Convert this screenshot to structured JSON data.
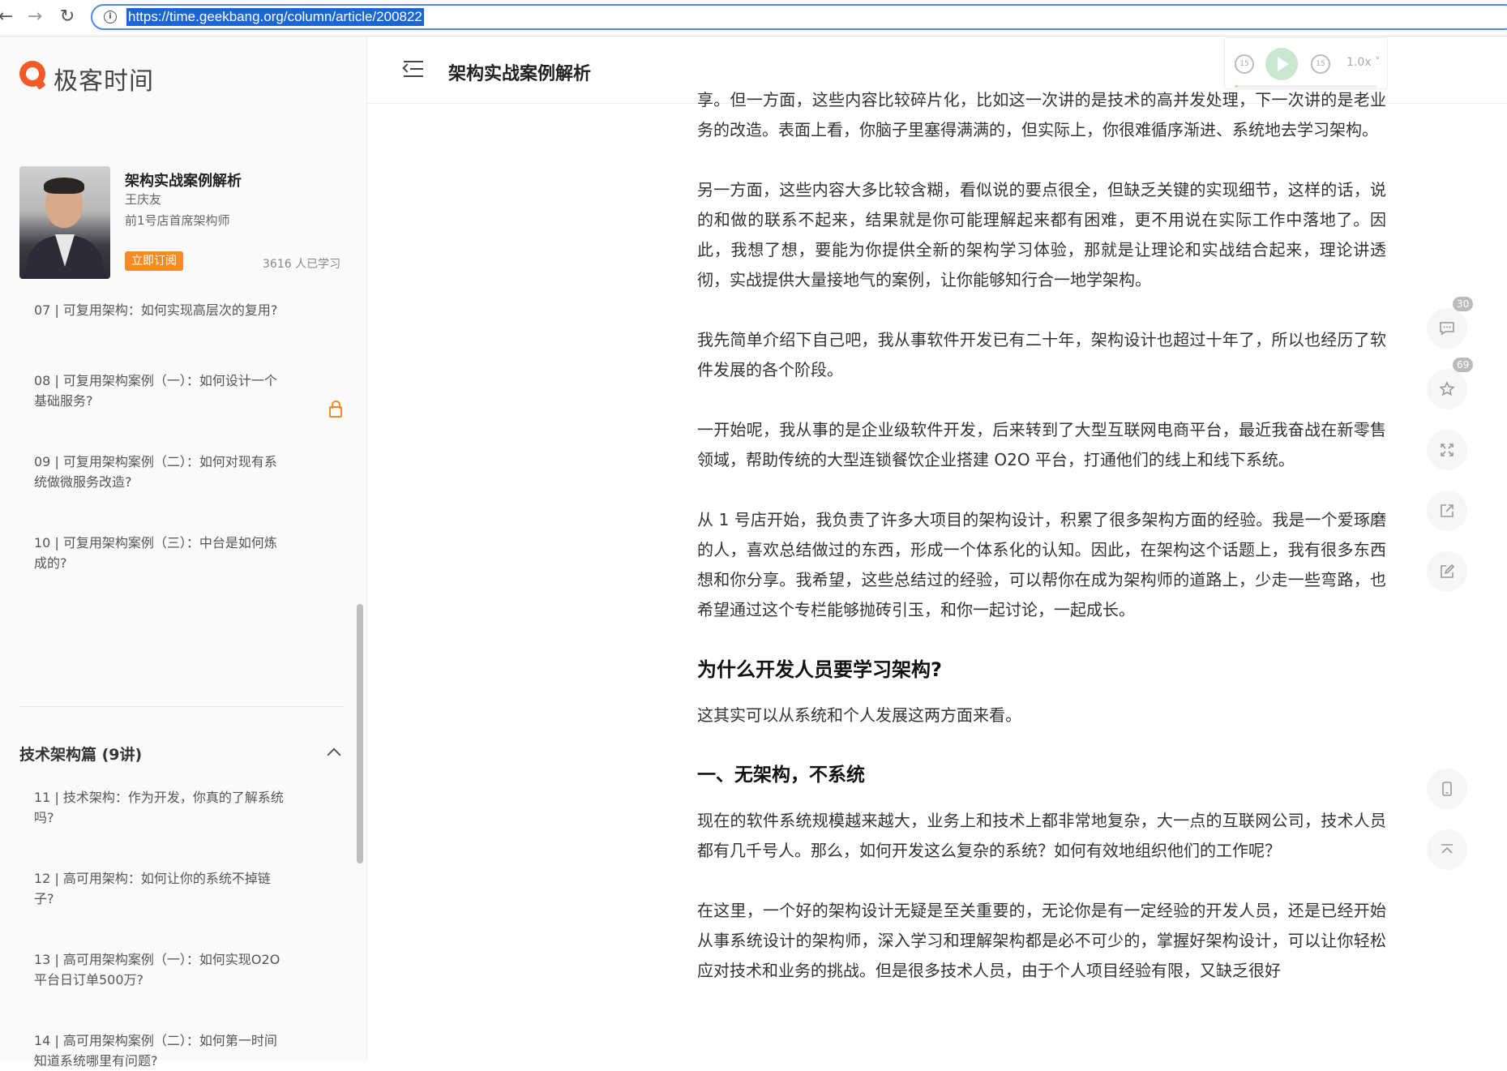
{
  "browser": {
    "url": "https://time.geekbang.org/column/article/200822",
    "back_glyph": "←",
    "forward_glyph": "→",
    "reload_glyph": "↻"
  },
  "sidebar": {
    "logo_text": "极客时间",
    "course": {
      "title": "架构实战案例解析",
      "author": "王庆友",
      "author_title": "前1号店首席架构师",
      "subscribe_label": "立即订阅",
      "learners": "3616 人已学习"
    },
    "toc_items": [
      {
        "label": "07 | 可复用架构：如何实现高层次的复用?"
      },
      {
        "label": "08 | 可复用架构案例（一）：如何设计一个基础服务?"
      },
      {
        "label": "09 | 可复用架构案例（二）：如何对现有系统做微服务改造?"
      },
      {
        "label": "10 | 可复用架构案例（三）：中台是如何炼成的?"
      }
    ],
    "section_title": "技术架构篇 (9讲)",
    "section_items": [
      {
        "label": "11 | 技术架构：作为开发，你真的了解系统吗?"
      },
      {
        "label": "12 | 高可用架构：如何让你的系统不掉链子?"
      },
      {
        "label": "13 | 高可用架构案例（一）：如何实现O2O平台日订单500万?"
      },
      {
        "label": "14 | 高可用架构案例（二）：如何第一时间知道系统哪里有问题?"
      }
    ]
  },
  "header": {
    "title": "架构实战案例解析"
  },
  "player": {
    "rewind_label": "15",
    "forward_label": "15",
    "speed": "1.0x ˅",
    "progress": 0.02
  },
  "article": {
    "p0": "享。但一方面，这些内容比较碎片化，比如这一次讲的是技术的高并发处理，下一次讲的是老业务的改造。表面上看，你脑子里塞得满满的，但实际上，你很难循序渐进、系统地去学习架构。",
    "p1": "另一方面，这些内容大多比较含糊，看似说的要点很全，但缺乏关键的实现细节，这样的话，说的和做的联系不起来，结果就是你可能理解起来都有困难，更不用说在实际工作中落地了。因此，我想了想，要能为你提供全新的架构学习体验，那就是让理论和实战结合起来，理论讲透彻，实战提供大量接地气的案例，让你能够知行合一地学架构。",
    "p2": "我先简单介绍下自己吧，我从事软件开发已有二十年，架构设计也超过十年了，所以也经历了软件发展的各个阶段。",
    "p3": "一开始呢，我从事的是企业级软件开发，后来转到了大型互联网电商平台，最近我奋战在新零售领域，帮助传统的大型连锁餐饮企业搭建 O2O 平台，打通他们的线上和线下系统。",
    "p4": "从 1 号店开始，我负责了许多大项目的架构设计，积累了很多架构方面的经验。我是一个爱琢磨的人，喜欢总结做过的东西，形成一个体系化的认知。因此，在架构这个话题上，我有很多东西想和你分享。我希望，这些总结过的经验，可以帮你在成为架构师的道路上，少走一些弯路，也希望通过这个专栏能够抛砖引玉，和你一起讨论，一起成长。",
    "h2": "为什么开发人员要学习架构?",
    "p5": "这其实可以从系统和个人发展这两方面来看。",
    "h3": "一、无架构，不系统",
    "p6": "现在的软件系统规模越来越大，业务上和技术上都非常地复杂，大一点的互联网公司，技术人员都有几千号人。那么，如何开发这么复杂的系统？如何有效地组织他们的工作呢？",
    "p7": "在这里，一个好的架构设计无疑是至关重要的，无论你是有一定经验的开发人员，还是已经开始从事系统设计的架构师，深入学习和理解架构都是必不可少的，掌握好架构设计，可以让你轻松应对技术和业务的挑战。但是很多技术人员，由于个人项目经验有限，又缺乏很好"
  },
  "float_toolbar": {
    "comments_count": "30",
    "favorites_count": "69"
  }
}
